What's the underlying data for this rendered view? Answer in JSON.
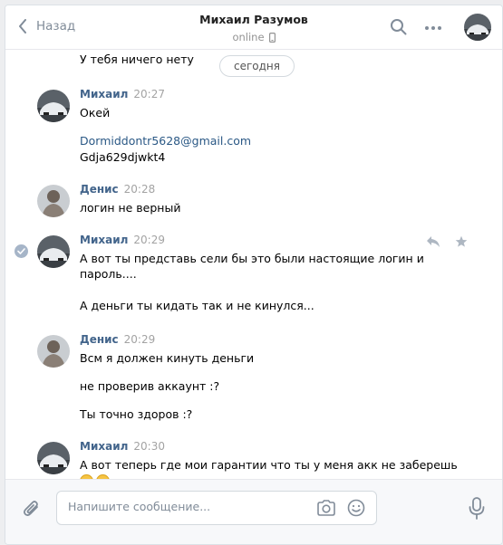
{
  "header": {
    "back_label": "Назад",
    "title": "Михаил Разумов",
    "status": "online"
  },
  "feed": {
    "date_pill": "сегодня",
    "top_partial_text": "У тебя ничего нету",
    "messages": [
      {
        "author": "Михаил",
        "time": "20:27",
        "lines": [
          "Окей",
          "Dormiddontr5628@gmail.com",
          "Gdja629djwkt4"
        ]
      },
      {
        "author": "Денис",
        "time": "20:28",
        "lines": [
          "логин не верный"
        ]
      },
      {
        "author": "Михаил",
        "time": "20:29",
        "lines": [
          "А вот ты представь сели бы это были настоящие логин и",
          "пароль....",
          "А деньги ты кидать так и не кинулся..."
        ]
      },
      {
        "author": "Денис",
        "time": "20:29",
        "lines": [
          "Всм я должен кинуть деньги",
          "не проверив аккаунт :?",
          "Ты точно здоров :?"
        ]
      },
      {
        "author": "Михаил",
        "time": "20:30",
        "lines": [
          "А вот теперь где мои гарантии что ты у меня акк не заберешь"
        ]
      }
    ]
  },
  "composer": {
    "placeholder": "Напишите сообщение..."
  },
  "colors": {
    "accent": "#42648b",
    "link": "#2a5885",
    "muted": "#818c99"
  }
}
